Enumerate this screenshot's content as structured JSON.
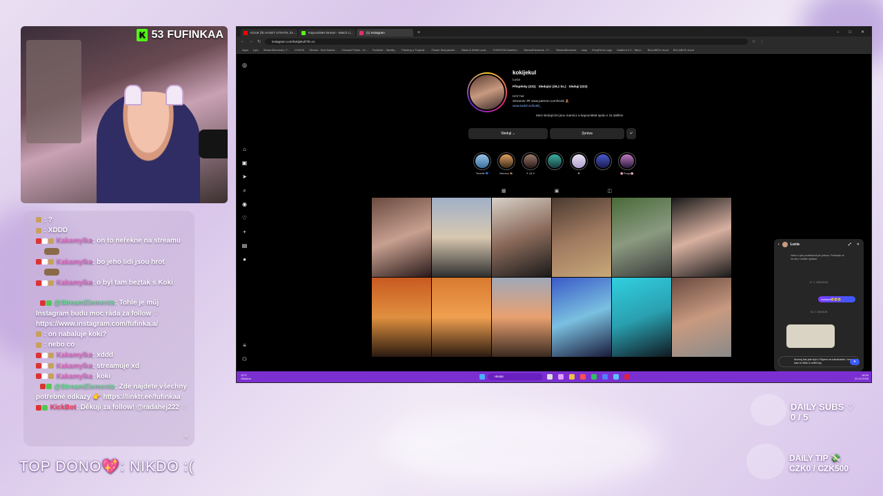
{
  "webcam": {
    "platform_badge": "K",
    "viewer_count": "53",
    "channel_name": "FUFINKAA"
  },
  "chat": [
    {
      "user": "",
      "text": ": ?"
    },
    {
      "user": "",
      "text": ": XDDD"
    },
    {
      "user": "Kakamylka",
      "text": ": on to neřekne na streamu"
    },
    {
      "user": "Kakamylka",
      "text": ": bo jeho lidi jsou hrot"
    },
    {
      "user": "Kakamylka",
      "text": ": o byl tam beztak s Koki"
    },
    {
      "user": "@StreamElements",
      "text": ": Tohle je můj Instagram budu moc ráda za follow ♡ https://www.instagram.com/fufinka.a/"
    },
    {
      "user": "",
      "text": ": on nabaluje koki?"
    },
    {
      "user": "",
      "text": ": nebo co"
    },
    {
      "user": "Kakamylka",
      "text": ": xddd"
    },
    {
      "user": "Kakamylka",
      "text": ": streamuje xd"
    },
    {
      "user": "Kakamylka",
      "text": ": koki"
    },
    {
      "user": "@StreamElements",
      "text": ": Zde najdete všechny potřebné odkazy 👉 https://linktr.ee/fufinkaa"
    },
    {
      "user": "KickBot",
      "text": ": Děkuji za follow! @radahej222 ♡"
    }
  ],
  "overlay": {
    "top_dono": "TOP DONO💖: NIKDO :(",
    "daily_subs_label": "DAILY SUBS ♡",
    "daily_subs_value": "0 / 5",
    "daily_tip_label": "DAILY TIP 💸",
    "daily_tip_value": "CZK0 / CZK500"
  },
  "browser": {
    "tabs": [
      "KOUK ŽE HASET UTRATIL ZA ...",
      "Kapoonik69 Stream - Watch Li...",
      "(1) Instagram"
    ],
    "url": "instagram.com/kokijekul/?hl=cs",
    "bookmarks": [
      "Apps",
      "bytu",
      "StreamElements | T...",
      "OYNOS",
      "Stream - Kick Dashb...",
      "Channel Points - Ki...",
      "Forthnite - TakeBy...",
      "Painting a Tropical...",
      "Flower field paintin...",
      "Black & White Land...",
      "FUFATION Dashbo...",
      "StreamElements - Fi...",
      "StreamElements",
      "uasp",
      "EmojiTerra Logo",
      "fufathon 2.0 - Tabul...",
      "BILLABOX cloud",
      "BILLABOX cloud"
    ]
  },
  "profile": {
    "username": "kokijekul",
    "name": "Lucia",
    "stats": [
      "Příspěvky (231)",
      "Sledující (29,1 tis.)",
      "Sledují (222)"
    ],
    "bio_1": "HAY her",
    "bio_2": "Streamer 🎮 www.patreon.com/Kokii 🧸",
    "bio_link": "www.twitch.tv/kokiii_",
    "followed_by": "Mezi sledujícími jsou marnicz a kapoonik69 spolu s 15 dalšími",
    "btn_follow": "Sleduji ⌄",
    "btn_message": "Zpráva",
    "btn_add": "+ⁱ",
    "highlights": [
      "Tenerife 💙",
      "Morocco 🐎",
      "☀ Lill ☀",
      "",
      "❤",
      "",
      "🌸Pongo🌸"
    ]
  },
  "dm": {
    "name": "Lucia",
    "msg1": "Video si jde prohlédnout jen jednou. Podívejte se na něj v mobilní aplikaci.",
    "date1": "17. 1. 2026 20:26",
    "sent": "Awwww🥹🥹🥹",
    "date2": "16. 2. 2026 8:25",
    "draft": "Ahoooj kdo jste byli s Filipem na halušukách, hrozně se nám to líbilo a chtěli by|"
  },
  "taskbar": {
    "temp": "10°C",
    "weather": "Oblačno",
    "search": "Hledat",
    "time": "18:30",
    "date": "22.03.2026"
  },
  "colors": {
    "kick": "#53fc18",
    "taskbar": "#7b2fd0",
    "ig_bg": "#000000"
  }
}
